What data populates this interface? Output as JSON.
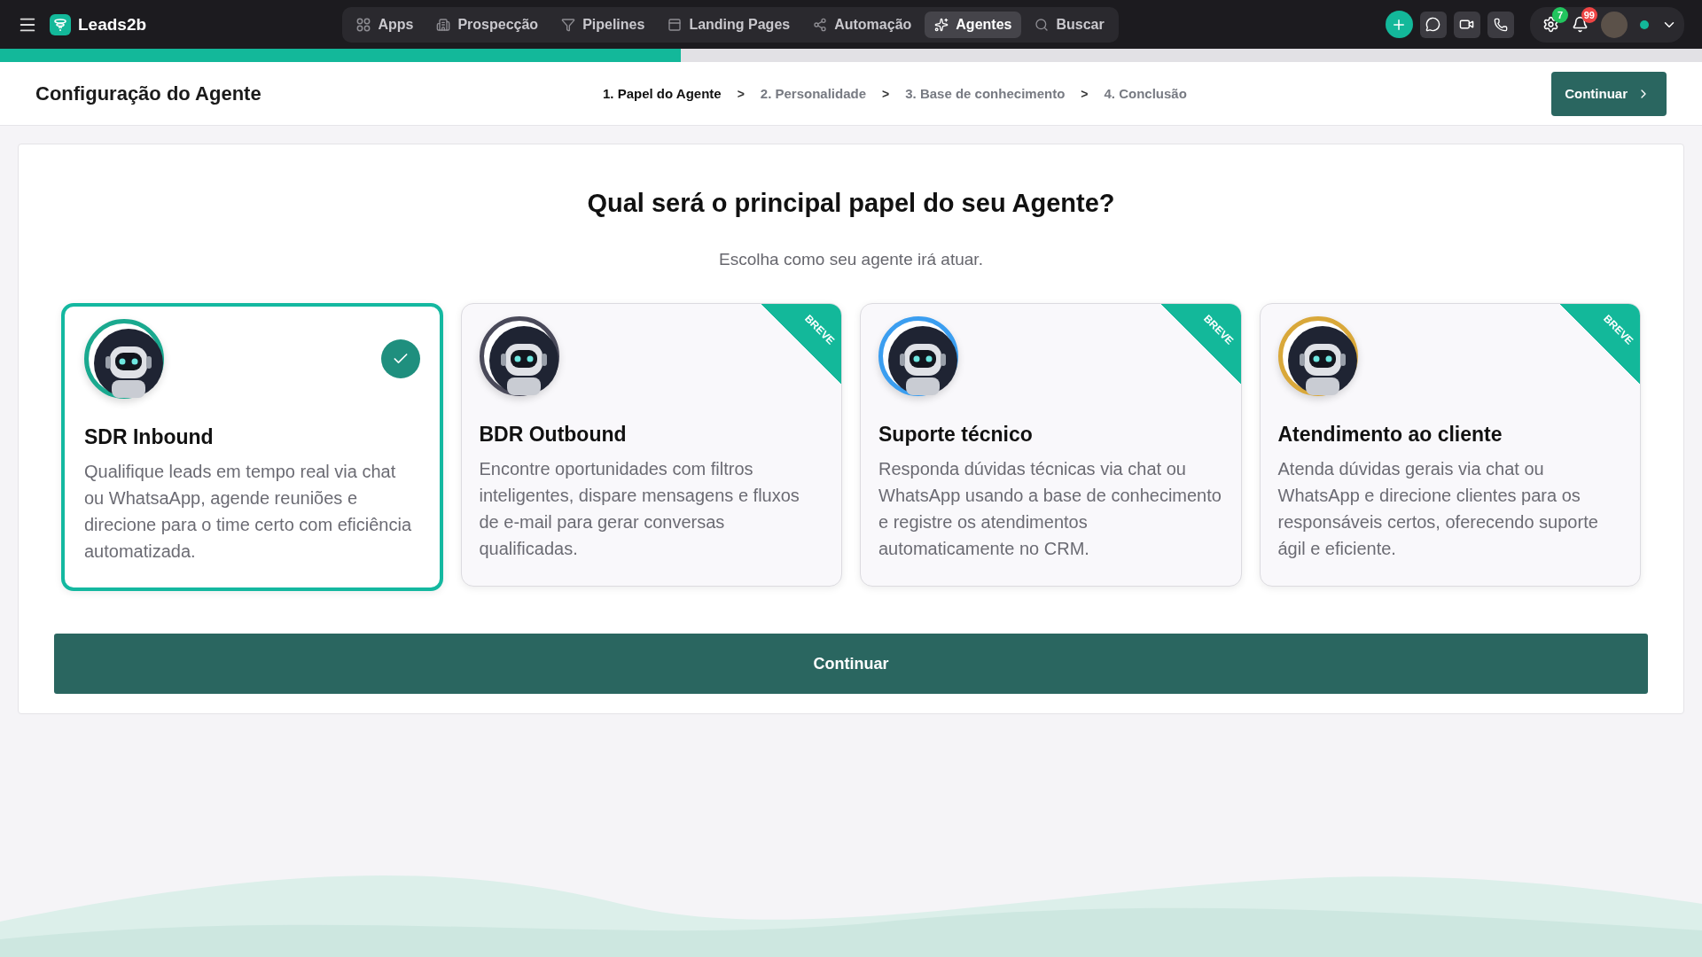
{
  "app": {
    "logo": "Leads2b"
  },
  "nav": [
    {
      "kind": "apps",
      "label": "Apps",
      "selected": false
    },
    {
      "kind": "prospect",
      "label": "Prospecção",
      "selected": false
    },
    {
      "kind": "filter",
      "label": "Pipelines",
      "selected": false
    },
    {
      "kind": "page",
      "label": "Landing Pages",
      "selected": false
    },
    {
      "kind": "flow",
      "label": "Automação",
      "selected": false
    },
    {
      "kind": "sparkle",
      "label": "Agentes",
      "selected": true
    },
    {
      "kind": "search",
      "label": "Buscar",
      "selected": false
    }
  ],
  "alerts": {
    "settings_badge": "7",
    "bell_badge": "99"
  },
  "user": {
    "online": true
  },
  "progress": {
    "level": 0.4
  },
  "header": {
    "title": "Configuração do Agente",
    "steps": [
      {
        "label": "1. Papel do Agente",
        "selected": true
      },
      {
        "label": "2. Personalidade",
        "selected": false
      },
      {
        "label": "3. Base de conhecimento",
        "selected": false
      },
      {
        "label": "4. Conclusão",
        "selected": false
      }
    ],
    "separators": [
      ">",
      ">",
      ">"
    ],
    "continue": "Continuar"
  },
  "main": {
    "title": "Qual será o principal papel do seu Agente?",
    "subtitle": "Escolha como seu agente irá atuar.",
    "cards": [
      {
        "name": "SDR Inbound",
        "description": "Qualifique leads em tempo real via chat ou WhatsaApp, agende reuniões e direcione para o time certo com eficiência automatizada.",
        "selected": true,
        "color": "#1aa98f"
      },
      {
        "name": "BDR Outbound",
        "description": "Encontre oportunidades com filtros inteligentes, dispare mensagens e fluxos de e-mail para gerar conversas qualificadas.",
        "selected": false,
        "badge": "BREVE",
        "color": "#4a4a5a"
      },
      {
        "name": "Suporte técnico",
        "description": "Responda dúvidas técnicas via chat ou WhatsApp usando a base de conhecimento e registre os atendimentos automaticamente no CRM.",
        "selected": false,
        "badge": "BREVE",
        "color": "#3b9ef0"
      },
      {
        "name": "Atendimento ao cliente",
        "description": "Atenda dúvidas gerais via chat ou WhatsApp e direcione clientes para os responsáveis certos, oferecendo suporte ágil e eficiente.",
        "selected": false,
        "badge": "BREVE",
        "color": "#d9a83a"
      }
    ],
    "button": "Continuar"
  }
}
